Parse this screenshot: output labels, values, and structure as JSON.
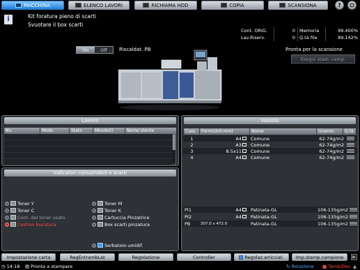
{
  "top_tabs": [
    {
      "label": "MACCHINA",
      "active": true
    },
    {
      "label": "ELENCO LAVORI",
      "active": false
    },
    {
      "label": "RICHIAMA HDD",
      "active": false
    },
    {
      "label": "COPIA",
      "active": false
    },
    {
      "label": "SCANSIONA",
      "active": false
    }
  ],
  "top_right": {
    "help": "?",
    "power": "⏻"
  },
  "message": {
    "line1": "Kit foratura pieno di scarti",
    "line2": "Svuotare il box scarti"
  },
  "counters": {
    "orig_label": "Cont. ORIG.",
    "orig_value": "0",
    "memory_label": "Memoria",
    "memory_value": "99.400%",
    "reserve_label": "Lav.Riserv.",
    "reserve_value": "0",
    "filesize_label": "Q.tà file",
    "filesize_value": "89.142%"
  },
  "machine": {
    "toggle_on": "On",
    "toggle_off": "Off",
    "warmup_label": "Riscaldat. PB",
    "status_text": "Pronta per la scansione",
    "sample_button": "Esegui stam. camp."
  },
  "job_panel": {
    "title": "Lavoro",
    "columns": [
      "No.",
      "Modo",
      "Stato",
      "Minuto(i)",
      "Nome utente"
    ],
    "rows": 6
  },
  "consumables": {
    "title": "Indicatori consumabili e scarti",
    "items": [
      {
        "label": "Toner Y",
        "state": "normal"
      },
      {
        "label": "Toner M",
        "state": "normal"
      },
      {
        "label": "Toner C",
        "state": "normal"
      },
      {
        "label": "Toner K",
        "state": "normal"
      },
      {
        "label": "Cont. del toner usato",
        "state": "dim"
      },
      {
        "label": "Cartuccia Pinzatrice",
        "state": "normal"
      },
      {
        "label": "Cestino bucatura",
        "state": "error"
      },
      {
        "label": "Box scarti pinzatura",
        "state": "normal"
      },
      {
        "label": "Serbatoio umidif.",
        "state": "normal"
      }
    ]
  },
  "tray_panel": {
    "title": "Vassoio",
    "columns": [
      "Cass.",
      "Form(Unit.mm)",
      "Nome",
      "Gramm.",
      "Q.tà"
    ],
    "rows": [
      {
        "tray": "1",
        "size": "A4",
        "name": "Comune",
        "weight": "62-74g/m2"
      },
      {
        "tray": "2",
        "size": "A3",
        "name": "Comune",
        "weight": "62-74g/m2"
      },
      {
        "tray": "3",
        "size": "8.5x11",
        "name": "Comune",
        "weight": "62-74g/m2"
      },
      {
        "tray": "4",
        "size": "A4",
        "name": "Comune",
        "weight": "62-74g/m2"
      },
      {
        "tray": "PI1",
        "size": "A4",
        "name": "Patinata-GL",
        "weight": "106-135g/m2"
      },
      {
        "tray": "PI2",
        "size": "A4",
        "name": "Patinata-GL",
        "weight": "106-135g/m2"
      },
      {
        "tray": "PB",
        "size": "307.0 x 472.0",
        "name": "Patinata-GL",
        "weight": "106-135g/m2"
      }
    ]
  },
  "bottom_tabs": [
    "Impostazione carta",
    "RegEntrambLat",
    "Regolazione",
    "Controller",
    "Regolaz.arricciat.",
    "Imp.stamp.campione"
  ],
  "status_bar": {
    "time": "14:18",
    "status": "Pronta a stampare",
    "rotation": "Rotazione",
    "tandem": "Tamb/Dev"
  }
}
